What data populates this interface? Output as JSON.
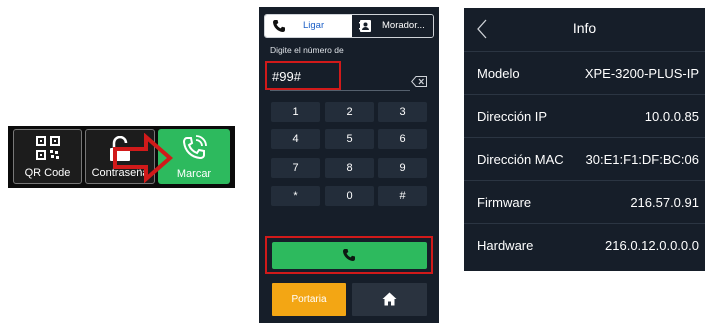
{
  "home": {
    "qr_label": "QR Code",
    "password_label": "Contraseña",
    "call_label": "Marcar"
  },
  "dialer": {
    "tab_call": "Ligar",
    "tab_residents": "Morador...",
    "prompt": "Digite el número de",
    "number": "#99#",
    "keys": [
      "1",
      "2",
      "3",
      "4",
      "5",
      "6",
      "7",
      "8",
      "9",
      "*",
      "0",
      "#"
    ],
    "portaria_label": "Portaria"
  },
  "info": {
    "title": "Info",
    "rows": [
      {
        "label": "Modelo",
        "value": "XPE-3200-PLUS-IP"
      },
      {
        "label": "Dirección IP",
        "value": "10.0.0.85"
      },
      {
        "label": "Dirección MAC",
        "value": "30:E1:F1:DF:BC:06"
      },
      {
        "label": "Firmware",
        "value": "216.57.0.91"
      },
      {
        "label": "Hardware",
        "value": "216.0.12.0.0.0.0"
      }
    ]
  },
  "colors": {
    "panel_bg": "#161e29",
    "accent_green": "#2dba5e",
    "highlight_red": "#d11a1a",
    "portaria_orange": "#f3a614",
    "tab_blue": "#1c5fc7"
  }
}
